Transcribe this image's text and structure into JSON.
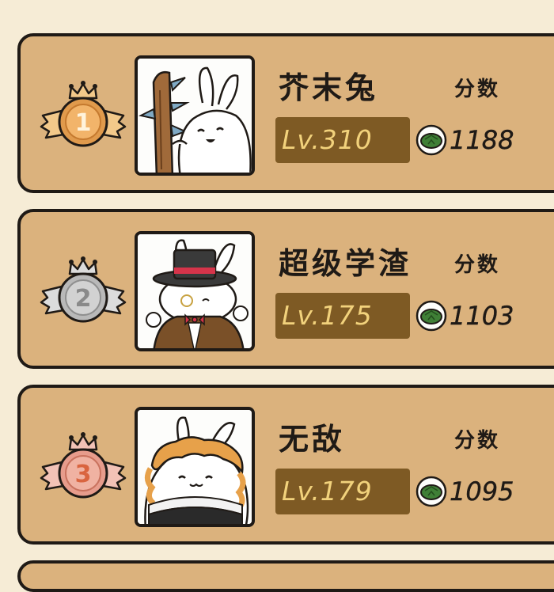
{
  "leaderboard": {
    "entries": [
      {
        "rank": "1",
        "name": "芥末兔",
        "level": "Lv.310",
        "score_label": "分数",
        "score": "1188",
        "medal_color": "#e09a4c",
        "avatar": "bunny-with-spiked-club-icon"
      },
      {
        "rank": "2",
        "name": "超级学渣",
        "level": "Lv.175",
        "score_label": "分数",
        "score": "1103",
        "medal_color": "#b9b9b9",
        "avatar": "bunny-with-top-hat-icon"
      },
      {
        "rank": "3",
        "name": "无敌",
        "level": "Lv.179",
        "score_label": "分数",
        "score": "1095",
        "medal_color": "#e79c8c",
        "avatar": "bunny-with-curly-hair-icon"
      }
    ]
  },
  "colors": {
    "card_bg": "#dbb27d",
    "page_bg": "#f6ecd6",
    "level_bg": "#7e5a24",
    "level_text": "#f2d27c",
    "coin_green": "#3f7f36"
  }
}
